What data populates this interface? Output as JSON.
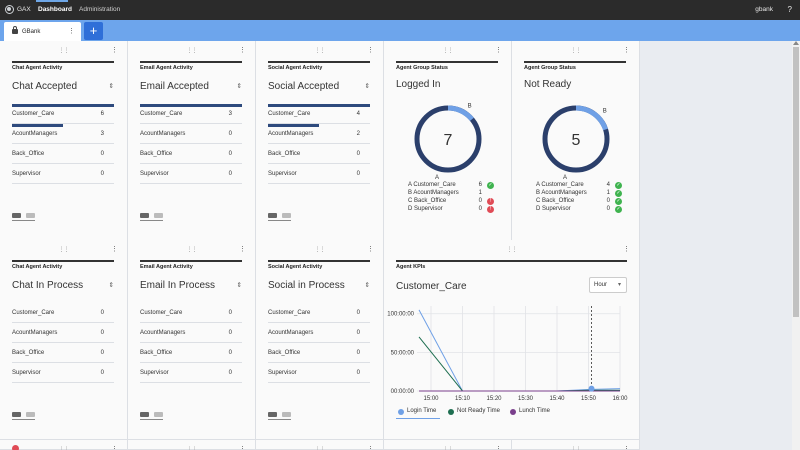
{
  "topbar": {
    "brand": "GAX",
    "nav": [
      "Dashboard",
      "Administration"
    ],
    "user": "gbank",
    "help": "?"
  },
  "tabs": [
    {
      "label": "GBank"
    }
  ],
  "add_label": "+",
  "cards_row1": [
    {
      "title": "Chat Agent Activity",
      "headline": "Chat Accepted",
      "rows": [
        {
          "label": "Customer_Care",
          "value": 6,
          "bar": 1.0
        },
        {
          "label": "AcountManagers",
          "value": 3,
          "bar": 0.5
        },
        {
          "label": "Back_Office",
          "value": 0,
          "bar": 0
        },
        {
          "label": "Supervisor",
          "value": 0,
          "bar": 0
        }
      ]
    },
    {
      "title": "Email Agent Activity",
      "headline": "Email Accepted",
      "rows": [
        {
          "label": "Customer_Care",
          "value": 3,
          "bar": 1.0
        },
        {
          "label": "AcountManagers",
          "value": 0,
          "bar": 0
        },
        {
          "label": "Back_Office",
          "value": 0,
          "bar": 0
        },
        {
          "label": "Supervisor",
          "value": 0,
          "bar": 0
        }
      ]
    },
    {
      "title": "Social Agent Activity",
      "headline": "Social Accepted",
      "rows": [
        {
          "label": "Customer_Care",
          "value": 4,
          "bar": 1.0
        },
        {
          "label": "AcountManagers",
          "value": 2,
          "bar": 0.5
        },
        {
          "label": "Back_Office",
          "value": 0,
          "bar": 0
        },
        {
          "label": "Supervisor",
          "value": 0,
          "bar": 0
        }
      ]
    }
  ],
  "cards_row2": [
    {
      "title": "Chat Agent Activity",
      "headline": "Chat In Process",
      "rows": [
        {
          "label": "Customer_Care",
          "value": 0
        },
        {
          "label": "AcountManagers",
          "value": 0
        },
        {
          "label": "Back_Office",
          "value": 0
        },
        {
          "label": "Supervisor",
          "value": 0
        }
      ]
    },
    {
      "title": "Email Agent Activity",
      "headline": "Email In Process",
      "rows": [
        {
          "label": "Customer_Care",
          "value": 0
        },
        {
          "label": "AcountManagers",
          "value": 0
        },
        {
          "label": "Back_Office",
          "value": 0
        },
        {
          "label": "Supervisor",
          "value": 0
        }
      ]
    },
    {
      "title": "Social Agent Activity",
      "headline": "Social in Process",
      "rows": [
        {
          "label": "Customer_Care",
          "value": 0
        },
        {
          "label": "AcountManagers",
          "value": 0
        },
        {
          "label": "Back_Office",
          "value": 0
        },
        {
          "label": "Supervisor",
          "value": 0
        }
      ]
    }
  ],
  "group_status": [
    {
      "title": "Agent Group Status",
      "headline": "Logged In",
      "total": "7",
      "seg_a": "A",
      "seg_b": "B",
      "legend": [
        {
          "label": "A Customer_Care",
          "value": "6",
          "status": "ok"
        },
        {
          "label": "B AcountManagers",
          "value": "1",
          "status": "none"
        },
        {
          "label": "C Back_Office",
          "value": "0",
          "status": "err"
        },
        {
          "label": "D Supervisor",
          "value": "0",
          "status": "err"
        }
      ],
      "fraction_b": 0.14
    },
    {
      "title": "Agent Group Status",
      "headline": "Not Ready",
      "total": "5",
      "seg_a": "A",
      "seg_b": "B",
      "legend": [
        {
          "label": "A Customer_Care",
          "value": "4",
          "status": "ok"
        },
        {
          "label": "B AcountManagers",
          "value": "1",
          "status": "ok"
        },
        {
          "label": "C Back_Office",
          "value": "0",
          "status": "ok"
        },
        {
          "label": "D Supervisor",
          "value": "0",
          "status": "ok"
        }
      ],
      "fraction_b": 0.2
    }
  ],
  "kpi": {
    "title": "Agent KPIs",
    "headline": "Customer_Care",
    "period": "Hour",
    "legend": [
      {
        "name": "Login Time",
        "color": "#6fa0e6"
      },
      {
        "name": "Not Ready Time",
        "color": "#1e6e50"
      },
      {
        "name": "Lunch Time",
        "color": "#7a3f8c"
      }
    ]
  },
  "chart_data": {
    "type": "line",
    "x": [
      "15:00",
      "15:10",
      "15:20",
      "15:30",
      "15:40",
      "15:50",
      "16:00"
    ],
    "ytick_labels": [
      "00:00:00",
      "50:00:00",
      "100:00:00"
    ],
    "series": [
      {
        "name": "Login Time",
        "values": [
          105,
          0,
          0,
          0,
          0,
          2,
          3
        ]
      },
      {
        "name": "Not Ready Time",
        "values": [
          70,
          0,
          0,
          0,
          0,
          1,
          1
        ]
      },
      {
        "name": "Lunch Time",
        "values": [
          0,
          0,
          0,
          0,
          0,
          0,
          0
        ]
      }
    ],
    "ylim": [
      0,
      110
    ],
    "grid": true
  }
}
